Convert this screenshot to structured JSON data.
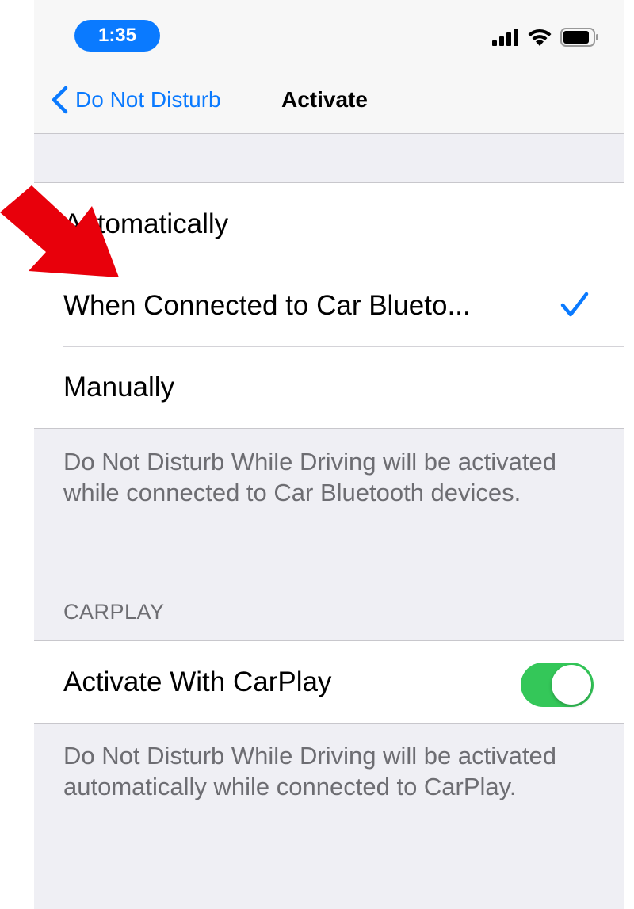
{
  "status_bar": {
    "time": "1:35",
    "icons": [
      "cellular-signal-icon",
      "wifi-icon",
      "battery-icon"
    ]
  },
  "nav": {
    "back_label": "Do Not Disturb",
    "title": "Activate"
  },
  "activate_options": {
    "items": [
      {
        "label": "Automatically",
        "selected": false
      },
      {
        "label": "When Connected to Car Blueto...",
        "selected": true
      },
      {
        "label": "Manually",
        "selected": false
      }
    ],
    "footer": "Do Not Disturb While Driving will be activated while connected to Car Bluetooth devices."
  },
  "carplay": {
    "header": "CARPLAY",
    "toggle_label": "Activate With CarPlay",
    "toggle_on": true,
    "footer": "Do Not Disturb While Driving will be activated automatically while connected to CarPlay."
  },
  "colors": {
    "accent": "#0a7aff",
    "toggle_on": "#34c759",
    "annotation_arrow": "#e8000b",
    "background_grouped": "#efeff4",
    "secondary_text": "#6d6d72"
  }
}
